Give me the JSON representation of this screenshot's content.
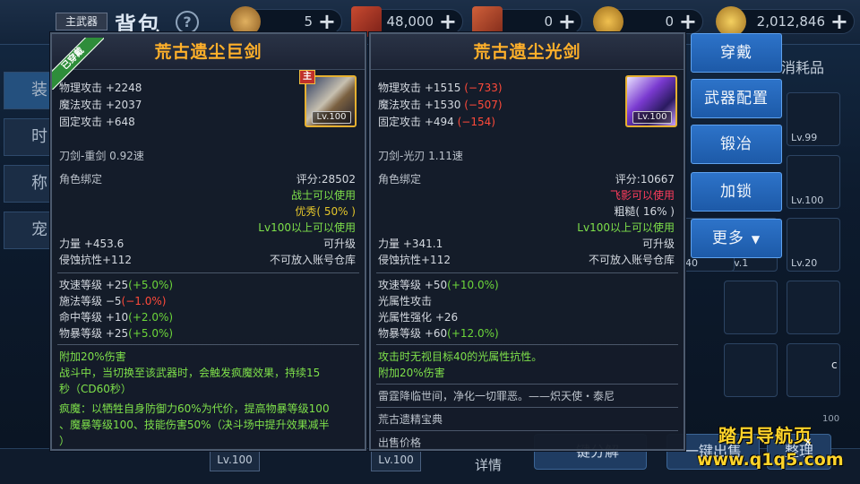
{
  "header": {
    "bag_title": "背包",
    "help_icon": "?",
    "currencies": [
      {
        "icon": "coin-token-icon",
        "value": "5",
        "color": "#b88a3a"
      },
      {
        "icon": "red-ticket-icon",
        "value": "48,000",
        "color": "#b8402a"
      },
      {
        "icon": "red-scroll-icon",
        "value": "0",
        "color": "#c0552e"
      },
      {
        "icon": "gold-coin-icon",
        "value": "0",
        "color": "#c89632"
      },
      {
        "icon": "gold-stack-icon",
        "value": "2,012,846",
        "color": "#d0a040"
      }
    ],
    "plus": "+"
  },
  "background": {
    "side_tabs": [
      "装",
      "时",
      "称",
      "宠"
    ],
    "category_tab": "消耗品",
    "slot_levels": [
      "Lv.99",
      "Lv.100",
      "Lv.1",
      "Lv.20",
      "40",
      "Lv.1"
    ],
    "bottom_levels": [
      "Lv.100",
      "Lv.100"
    ],
    "detail_label": "详情",
    "bottom_buttons": [
      "一键分解",
      "一键出售",
      "整理"
    ],
    "close_label": "x",
    "side_letter": "c",
    "bag_capacity": "100"
  },
  "equipped_panel": {
    "slot_tag": "主武器",
    "equipped_ribbon": "已穿戴",
    "name": "荒古遗尘巨剑",
    "main_badge": "主",
    "icon_level": "Lv.100",
    "stats": [
      {
        "label": "物理攻击 +2248"
      },
      {
        "label": "魔法攻击 +2037"
      },
      {
        "label": "固定攻击 +648"
      }
    ],
    "type_line": "刀剑-重剑    0.92速",
    "bind": "角色绑定",
    "score": "评分:28502",
    "class_req": "战士可以使用",
    "quality": "优秀( 50% )",
    "level_req": "Lv100以上可以使用",
    "strength": "力量 +453.6",
    "upgrade": "可升级",
    "corrosion": "侵蚀抗性+112",
    "storage": "不可放入账号仓库",
    "secondary": [
      {
        "label": "攻速等级 +25",
        "delta": "(+5.0%)",
        "tone": "green"
      },
      {
        "label": "施法等级 −5",
        "delta": "(−1.0%)",
        "tone": "red"
      },
      {
        "label": "命中等级 +10",
        "delta": "(+2.0%)",
        "tone": "green"
      },
      {
        "label": "物暴等级 +25",
        "delta": "(+5.0%)",
        "tone": "green"
      }
    ],
    "effects": [
      "附加20%伤害",
      "战斗中，当切换至该武器时，会触发疯魔效果，持续15",
      "秒（CD60秒）",
      "疯魔：以牺牲自身防御力60%为代价，提高物暴等级100",
      "、魔暴等级100、技能伤害50%（决斗场中提升效果减半",
      "）"
    ]
  },
  "compare_panel": {
    "name": "荒古遗尘光剑",
    "icon_level": "Lv.100",
    "stats": [
      {
        "label": "物理攻击 +1515",
        "delta": "(−733)"
      },
      {
        "label": "魔法攻击 +1530",
        "delta": "(−507)"
      },
      {
        "label": "固定攻击 +494",
        "delta": "(−154)"
      }
    ],
    "type_line": "刀剑-光刃    1.11速",
    "bind": "角色绑定",
    "score": "评分:10667",
    "class_req": "飞影可以使用",
    "quality": "粗糙( 16% )",
    "level_req": "Lv100以上可以使用",
    "strength": "力量 +341.1",
    "upgrade": "可升级",
    "corrosion": "侵蚀抗性+112",
    "storage": "不可放入账号仓库",
    "secondary": [
      {
        "label": "攻速等级 +50",
        "delta": "(+10.0%)",
        "tone": "green"
      },
      {
        "label": "光属性攻击",
        "delta": "",
        "tone": "white"
      },
      {
        "label": "光属性强化 +26",
        "delta": "",
        "tone": "white"
      },
      {
        "label": "物暴等级 +60",
        "delta": "(+12.0%)",
        "tone": "green"
      }
    ],
    "effects": [
      "攻击时无视目标40的光属性抗性。",
      "附加20%伤害"
    ],
    "flavor": "雷霆降临世间，净化一切罪恶。——炽天使・泰尼",
    "source": "荒古遗精宝典",
    "sell": "出售价格"
  },
  "actions": {
    "wear": "穿戴",
    "weapon_config": "武器配置",
    "forge": "锻冶",
    "lock": "加锁",
    "more": "更多",
    "more_arrow": "▼"
  },
  "watermark": {
    "line1": "踏月导航页",
    "line2": "www.q1q5.com"
  }
}
